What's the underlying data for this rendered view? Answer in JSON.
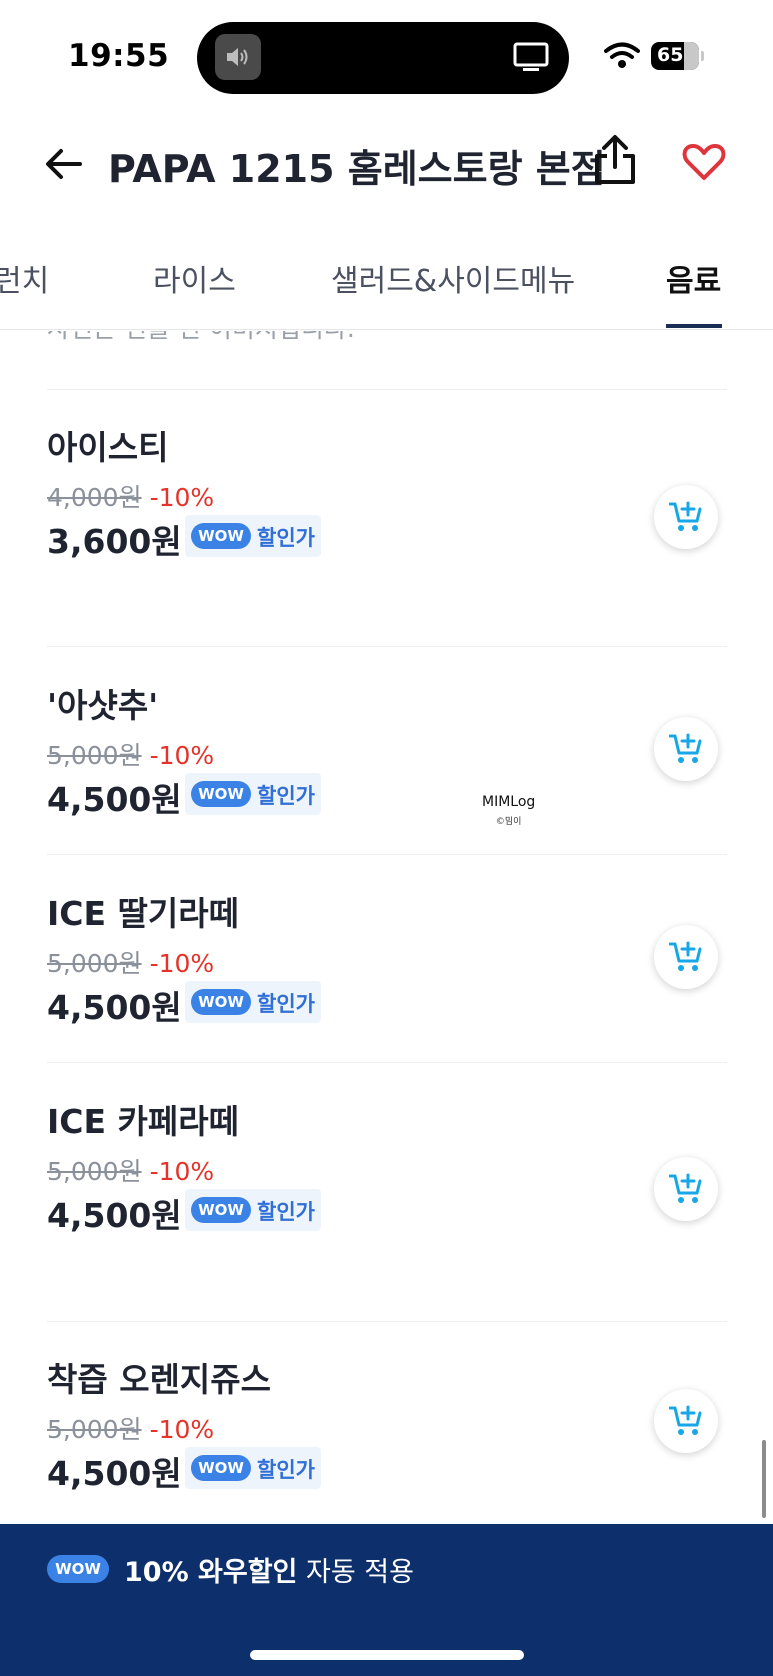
{
  "status_bar": {
    "time": "19:55",
    "battery": "65"
  },
  "header": {
    "title": "PAPA 1215 홈레스토랑 본점"
  },
  "tabs": [
    {
      "label": "런치",
      "active": false
    },
    {
      "label": "라이스",
      "active": false
    },
    {
      "label": "샐러드&사이드메뉴",
      "active": false
    },
    {
      "label": "음료",
      "active": true
    }
  ],
  "notice": "사진은 연출 된 이미지입니다.",
  "menu": [
    {
      "name": "아이스티",
      "original_price": "4,000원",
      "discount": "-10%",
      "price": "3,600원",
      "badge": "WOW",
      "badge_label": "할인가"
    },
    {
      "name": "'아샷추'",
      "original_price": "5,000원",
      "discount": "-10%",
      "price": "4,500원",
      "badge": "WOW",
      "badge_label": "할인가"
    },
    {
      "name": "ICE 딸기라떼",
      "original_price": "5,000원",
      "discount": "-10%",
      "price": "4,500원",
      "badge": "WOW",
      "badge_label": "할인가"
    },
    {
      "name": "ICE 카페라떼",
      "original_price": "5,000원",
      "discount": "-10%",
      "price": "4,500원",
      "badge": "WOW",
      "badge_label": "할인가"
    },
    {
      "name": "착즙 오렌지쥬스",
      "original_price": "5,000원",
      "discount": "-10%",
      "price": "4,500원",
      "badge": "WOW",
      "badge_label": "할인가"
    }
  ],
  "watermark": {
    "main": "MIMLog",
    "sub": "©밈이"
  },
  "bottom_banner": {
    "badge": "WOW",
    "strong": "10% 와우할인",
    "text": " 자동 적용"
  },
  "colors": {
    "accent_blue": "#3b82e6",
    "discount_red": "#e5332a",
    "banner_navy": "#0d2f6b",
    "heart_red": "#e0343c",
    "cart_cyan": "#19a6e8"
  },
  "icons": [
    "back-arrow-icon",
    "share-icon",
    "heart-icon",
    "add-to-cart-icon",
    "wifi-icon",
    "speaker-icon",
    "tv-icon"
  ]
}
